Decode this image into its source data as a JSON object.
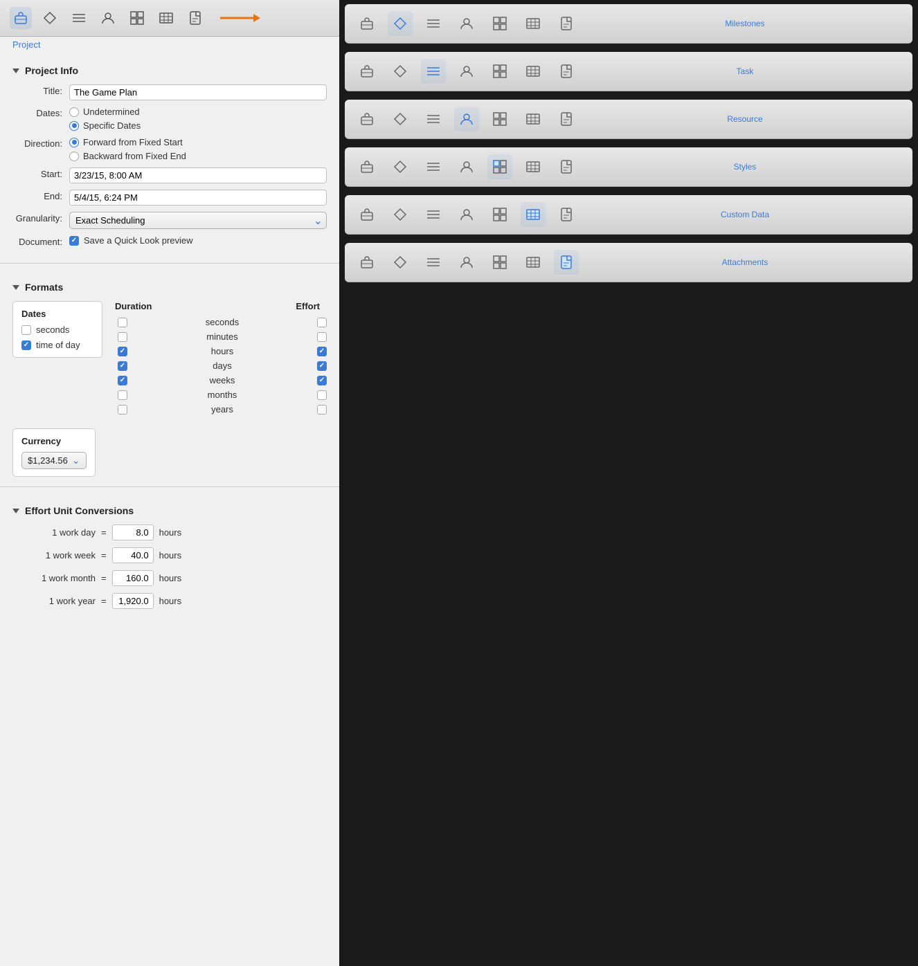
{
  "toolbar": {
    "items": [
      {
        "name": "project",
        "label": "Project",
        "active": true
      },
      {
        "name": "milestones",
        "label": "",
        "active": false
      },
      {
        "name": "task",
        "label": "",
        "active": false
      },
      {
        "name": "resource",
        "label": "",
        "active": false
      },
      {
        "name": "styles",
        "label": "",
        "active": false
      },
      {
        "name": "custom-data",
        "label": "",
        "active": false
      },
      {
        "name": "attachments",
        "label": "",
        "active": false
      }
    ],
    "active_label": "Project"
  },
  "project_info": {
    "header": "Project Info",
    "title_label": "Title:",
    "title_value": "The Game Plan",
    "dates_label": "Dates:",
    "dates_options": [
      "Undetermined",
      "Specific Dates"
    ],
    "dates_selected": "Specific Dates",
    "direction_label": "Direction:",
    "direction_options": [
      "Forward from Fixed Start",
      "Backward from Fixed End"
    ],
    "direction_selected": "Forward from Fixed Start",
    "start_label": "Start:",
    "start_value": "3/23/15, 8:00 AM",
    "end_label": "End:",
    "end_value": "5/4/15, 6:24 PM",
    "granularity_label": "Granularity:",
    "granularity_value": "Exact Scheduling",
    "document_label": "Document:",
    "document_text": "Save a Quick Look preview",
    "document_checked": true
  },
  "formats": {
    "header": "Formats",
    "dates_box_title": "Dates",
    "dates_items": [
      {
        "label": "seconds",
        "checked": false
      },
      {
        "label": "time of day",
        "checked": true
      }
    ],
    "duration_header": "Duration",
    "effort_header": "Effort",
    "duration_rows": [
      {
        "label": "seconds",
        "dur_checked": false,
        "eff_checked": false
      },
      {
        "label": "minutes",
        "dur_checked": false,
        "eff_checked": false
      },
      {
        "label": "hours",
        "dur_checked": true,
        "eff_checked": true
      },
      {
        "label": "days",
        "dur_checked": true,
        "eff_checked": true
      },
      {
        "label": "weeks",
        "dur_checked": true,
        "eff_checked": true
      },
      {
        "label": "months",
        "dur_checked": false,
        "eff_checked": false
      },
      {
        "label": "years",
        "dur_checked": false,
        "eff_checked": false
      }
    ],
    "currency_title": "Currency",
    "currency_value": "$1,234.56"
  },
  "effort_conversions": {
    "header": "Effort Unit Conversions",
    "rows": [
      {
        "label": "1 work day",
        "value": "8.0",
        "unit": "hours"
      },
      {
        "label": "1 work week",
        "value": "40.0",
        "unit": "hours"
      },
      {
        "label": "1 work month",
        "value": "160.0",
        "unit": "hours"
      },
      {
        "label": "1 work year",
        "value": "1,920.0",
        "unit": "hours"
      }
    ]
  },
  "right_panel": {
    "sections": [
      {
        "name": "milestones",
        "label": "Milestones",
        "active_icon": 1
      },
      {
        "name": "task",
        "label": "Task",
        "active_icon": 2
      },
      {
        "name": "resource",
        "label": "Resource",
        "active_icon": 3
      },
      {
        "name": "styles",
        "label": "Styles",
        "active_icon": 4
      },
      {
        "name": "custom-data",
        "label": "Custom Data",
        "active_icon": 5
      },
      {
        "name": "attachments",
        "label": "Attachments",
        "active_icon": 6
      }
    ]
  },
  "colors": {
    "blue": "#3a7bd5",
    "orange": "#e07818"
  }
}
